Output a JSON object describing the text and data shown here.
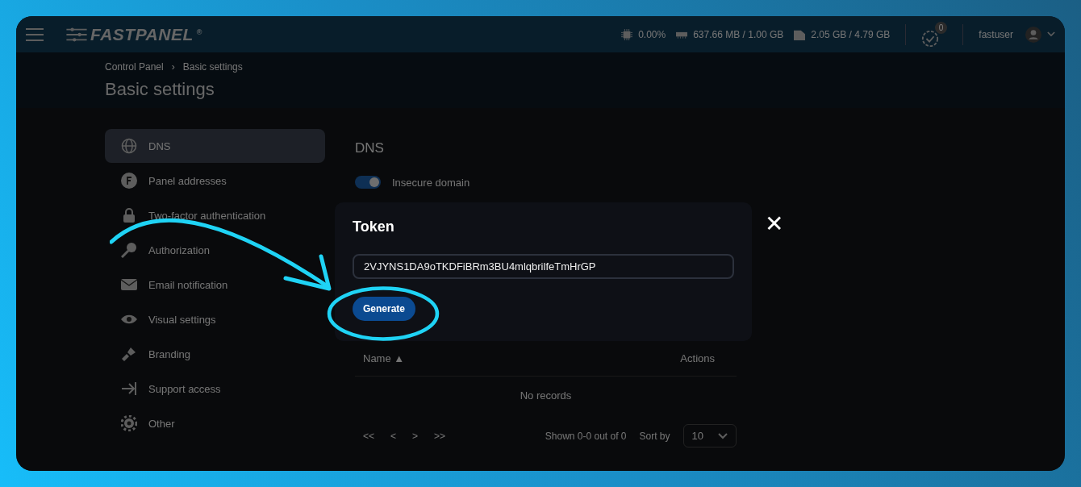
{
  "header": {
    "logo": "FASTPANEL",
    "logo_mark": "®",
    "stats": [
      {
        "value": "0.00%"
      },
      {
        "value": "637.66 MB / 1.00 GB"
      },
      {
        "value": "2.05 GB / 4.79 GB"
      }
    ],
    "tasks_badge": "0",
    "user": "fastuser"
  },
  "breadcrumbs": [
    "Control Panel",
    "›",
    "Basic settings"
  ],
  "page_title": "Basic settings",
  "sidebar": {
    "items": [
      {
        "label": "DNS",
        "selected": true
      },
      {
        "label": "Panel addresses",
        "selected": false
      },
      {
        "label": "Two-factor authentication",
        "selected": false
      },
      {
        "label": "Authorization",
        "selected": false
      },
      {
        "label": "Email notification",
        "selected": false
      },
      {
        "label": "Visual settings",
        "selected": false
      },
      {
        "label": "Branding",
        "selected": false
      },
      {
        "label": "Support access",
        "selected": false
      },
      {
        "label": "Other",
        "selected": false
      }
    ]
  },
  "content": {
    "title": "DNS",
    "toggle": {
      "label": "Insecure domain",
      "on": true
    },
    "table": {
      "columns": [
        "Name ▲",
        "Actions"
      ],
      "empty": "No records"
    },
    "pager": {
      "buttons": [
        "<<",
        "<",
        ">",
        ">>"
      ],
      "shown": "Shown 0-0 out of 0",
      "sort_label": "Sort by",
      "page_size": "10"
    }
  },
  "modal": {
    "title": "Token",
    "token": "2VJYNS1DA9oTKDFiBRm3BU4mlqbrilfeTmHrGP",
    "button": "Generate",
    "close": "✕"
  }
}
